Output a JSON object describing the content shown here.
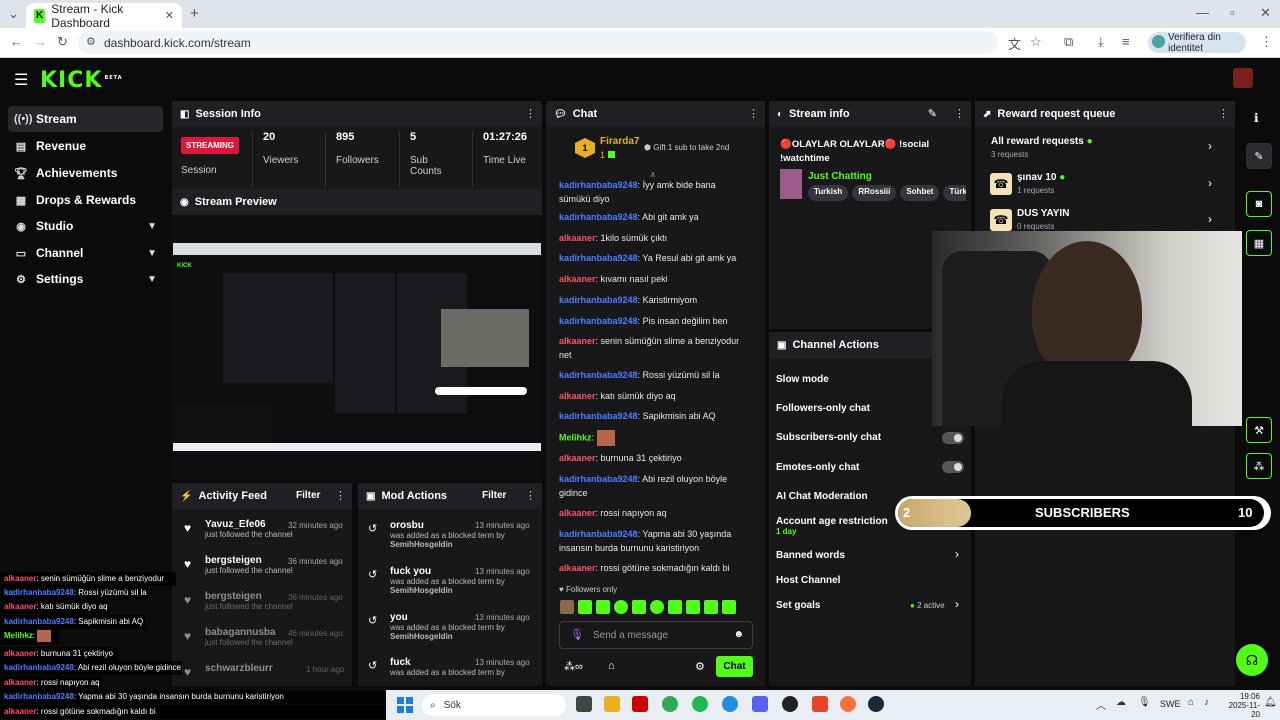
{
  "browser": {
    "tab_title": "Stream - Kick Dashboard",
    "url": "dashboard.kick.com/stream",
    "profile_label": "Verifiera din identitet",
    "new_tab_icon": "plus-icon"
  },
  "brand": {
    "logo_text": "KICK",
    "beta": "BETA"
  },
  "nav": {
    "items": [
      {
        "label": "Stream",
        "icon": "broadcast-icon"
      },
      {
        "label": "Revenue",
        "icon": "revenue-icon"
      },
      {
        "label": "Achievements",
        "icon": "trophy-icon"
      },
      {
        "label": "Drops & Rewards",
        "icon": "gift-icon"
      },
      {
        "label": "Studio",
        "icon": "studio-icon"
      },
      {
        "label": "Channel",
        "icon": "channel-icon"
      },
      {
        "label": "Settings",
        "icon": "gear-icon"
      }
    ]
  },
  "session": {
    "title": "Session Info",
    "status_badge": "STREAMING",
    "status_label": "Session",
    "viewers_value": "20",
    "viewers_label": "Viewers",
    "followers_value": "895",
    "followers_label": "Followers",
    "subs_value": "5",
    "subs_label": "Sub Counts",
    "time_value": "01:27:26",
    "time_label": "Time Live"
  },
  "preview": {
    "title": "Stream Preview"
  },
  "activity": {
    "title": "Activity Feed",
    "filter": "Filter",
    "items": [
      {
        "name": "Yavuz_Efe06",
        "sub": "just followed the channel",
        "time": "32 minutes ago"
      },
      {
        "name": "bergsteigen",
        "sub": "just followed the channel",
        "time": "36 minutes ago"
      },
      {
        "name": "bergsteigen",
        "sub": "just followed the channel",
        "time": "36 minutes ago"
      },
      {
        "name": "babagannusba",
        "sub": "just followed the channel",
        "time": "46 minutes ago"
      },
      {
        "name": "schwarzbleurr",
        "sub": "",
        "time": "1 hour ago"
      }
    ]
  },
  "mod": {
    "title": "Mod Actions",
    "filter": "Filter",
    "items": [
      {
        "term": "orosbu",
        "sub": "was added as a blocked term by",
        "by": "SemihHosgeldin",
        "time": "13 minutes ago"
      },
      {
        "term": "fuck you",
        "sub": "was added as a blocked term by",
        "by": "SemihHosgeldin",
        "time": "13 minutes ago"
      },
      {
        "term": "you",
        "sub": "was added as a blocked term by",
        "by": "SemihHosgeldin",
        "time": "13 minutes ago"
      },
      {
        "term": "fuck",
        "sub": "was added as a blocked term by",
        "by": "",
        "time": "13 minutes ago"
      }
    ]
  },
  "chat": {
    "title": "Chat",
    "pinned_user": "Firarda7",
    "pinned_count": "1",
    "gift_text": "Gift 1 sub to take 2nd",
    "messages": [
      {
        "user": "kadirhanbaba9248",
        "cls": "u1",
        "text": "İyy amk bide bana sümükü diyo"
      },
      {
        "user": "kadirhanbaba9248",
        "cls": "u1",
        "text": "Abi git amk ya"
      },
      {
        "user": "alkaaner",
        "cls": "u2",
        "text": "1kilo sümük çıktı"
      },
      {
        "user": "kadirhanbaba9248",
        "cls": "u1",
        "text": "Ya Resul abi git amk ya"
      },
      {
        "user": "alkaaner",
        "cls": "u2",
        "text": "kıvamı nasıl peki"
      },
      {
        "user": "kadirhanbaba9248",
        "cls": "u1",
        "text": "Karistirmiyom"
      },
      {
        "user": "kadirhanbaba9248",
        "cls": "u1",
        "text": "Pis insan değilim ben"
      },
      {
        "user": "alkaaner",
        "cls": "u2",
        "text": "senin sümüğün slime a benziyodur net"
      },
      {
        "user": "kadirhanbaba9248",
        "cls": "u1",
        "text": "Rossi yüzümü sil la"
      },
      {
        "user": "alkaaner",
        "cls": "u2",
        "text": "katı sümük diyo aq"
      },
      {
        "user": "kadirhanbaba9248",
        "cls": "u1",
        "text": "Sapikmisin abi AQ"
      },
      {
        "user": "Melihkz",
        "cls": "u3",
        "text": ""
      },
      {
        "user": "alkaaner",
        "cls": "u2",
        "text": "burnuna 31 çektiriyo"
      },
      {
        "user": "kadirhanbaba9248",
        "cls": "u1",
        "text": "Abi rezil oluyon böyle gidince"
      },
      {
        "user": "alkaaner",
        "cls": "u2",
        "text": "rossi napıyon aq"
      },
      {
        "user": "kadirhanbaba9248",
        "cls": "u1",
        "text": "Yapma abi 30 yaşında insansın burda burnunu karistiriyon"
      },
      {
        "user": "alkaaner",
        "cls": "u2",
        "text": "rossi götüne sokmadığın kaldı bi"
      }
    ],
    "followers_only": "Followers only",
    "input_placeholder": "Send a message",
    "send_label": "Chat"
  },
  "stream_info": {
    "title": "Stream info",
    "stream_title": "🔴OLAYLAR OLAYLAR🔴 !social !watchtime",
    "category": "Just Chatting",
    "tags": [
      "Turkish",
      "RRossiii",
      "Sohbet",
      "Türk"
    ]
  },
  "reward_queue": {
    "title": "Reward request queue",
    "all_label": "All reward requests",
    "all_count": "3 requests",
    "items": [
      {
        "name": "şınav 10",
        "count": "1 requests"
      },
      {
        "name": "DUS YAYIN",
        "count": "0 requests"
      }
    ]
  },
  "channel_actions": {
    "title": "Channel Actions",
    "slow_mode": "Slow mode",
    "followers_only": "Followers-only chat",
    "subscribers_only": "Subscribers-only chat",
    "emotes_only": "Emotes-only chat",
    "ai_moderation": "AI Chat Moderation",
    "account_age": "Account age restriction",
    "account_age_value": "1 day",
    "banned_words": "Banned words",
    "host_channel": "Host Channel",
    "set_goals": "Set goals",
    "goals_active": "2 active"
  },
  "sub_goal": {
    "current": "2",
    "label": "SUBSCRIBERS",
    "target": "10",
    "progress": 0.2
  },
  "overlay_chat": [
    {
      "user": "alkaaner",
      "cls": "u2",
      "text": ": senin sümüğün slime a benziyodur net"
    },
    {
      "user": "kadirhanbaba9248",
      "cls": "u1",
      "text": ": Rossi yüzümü sil la"
    },
    {
      "user": "alkaaner",
      "cls": "u2",
      "text": ": katı sümük diyo aq"
    },
    {
      "user": "kadirhanbaba9248",
      "cls": "u1",
      "text": ": Sapikmisin abi AQ"
    },
    {
      "user": "Melihkz",
      "cls": "u3",
      "text": ":"
    },
    {
      "user": "alkaaner",
      "cls": "u2",
      "text": ": burnuna 31 çektiriyo"
    },
    {
      "user": "kadirhanbaba9248",
      "cls": "u1",
      "text": ": Abi rezil oluyon böyle gidince"
    },
    {
      "user": "alkaaner",
      "cls": "u2",
      "text": ": rossi napıyon aq"
    },
    {
      "user": "kadirhanbaba9248",
      "cls": "u1",
      "text": ": Yapma abi 30 yaşında insansın burda burnunu karistiriyon"
    },
    {
      "user": "alkaaner",
      "cls": "u2",
      "text": ": rossi götüne sokmadığın kaldı bi"
    }
  ],
  "taskbar": {
    "search_label": "Sök",
    "lang": "SWE",
    "time": "19:06",
    "date": "2025-11-20"
  }
}
